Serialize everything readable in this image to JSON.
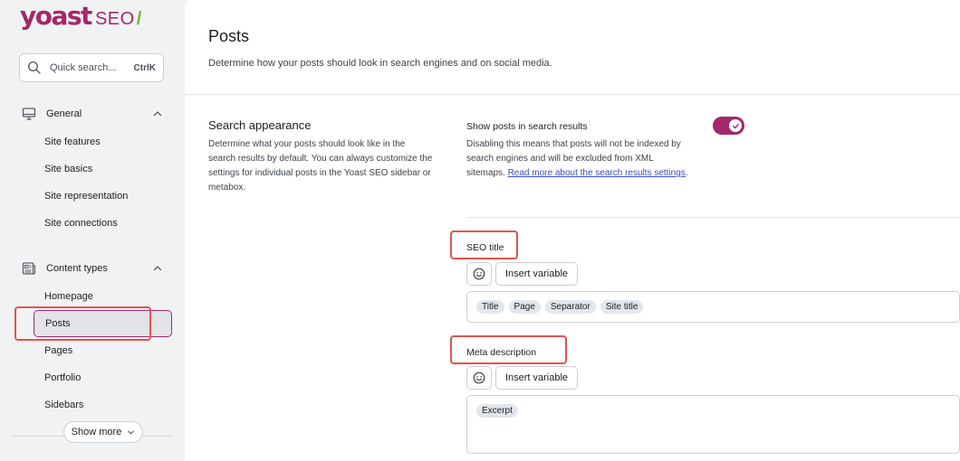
{
  "brand": {
    "name": "yoast",
    "suffix": "SEO",
    "slash": "/",
    "primary_color": "#a4286a",
    "accent_color": "#77b227"
  },
  "search": {
    "placeholder": "Quick search...",
    "shortcut": "CtrlK"
  },
  "sidebar": {
    "groups": [
      {
        "label": "General",
        "icon": "desktop-icon",
        "items": [
          "Site features",
          "Site basics",
          "Site representation",
          "Site connections"
        ]
      },
      {
        "label": "Content types",
        "icon": "newspaper-icon",
        "items": [
          "Homepage",
          "Posts",
          "Pages",
          "Portfolio",
          "Sidebars"
        ]
      }
    ],
    "active_item": "Posts",
    "show_more": "Show more"
  },
  "page": {
    "title": "Posts",
    "description": "Determine how your posts should look in search engines and on social media."
  },
  "search_appearance": {
    "title": "Search appearance",
    "description": "Determine what your posts should look like in the search results by default. You can always customize the settings for individual posts in the Yoast SEO sidebar or metabox.",
    "option_label": "Show posts in search results",
    "option_description": "Disabling this means that posts will not be indexed by search engines and will be excluded from XML sitemaps.",
    "option_link": "Read more about the search results settings",
    "option_end": ".",
    "toggle_on": true
  },
  "seo_title": {
    "label": "SEO title",
    "insert_variable": "Insert variable",
    "chips": [
      "Title",
      "Page",
      "Separator",
      "Site title"
    ]
  },
  "meta_description": {
    "label": "Meta description",
    "insert_variable": "Insert variable",
    "chips": [
      "Excerpt"
    ]
  }
}
